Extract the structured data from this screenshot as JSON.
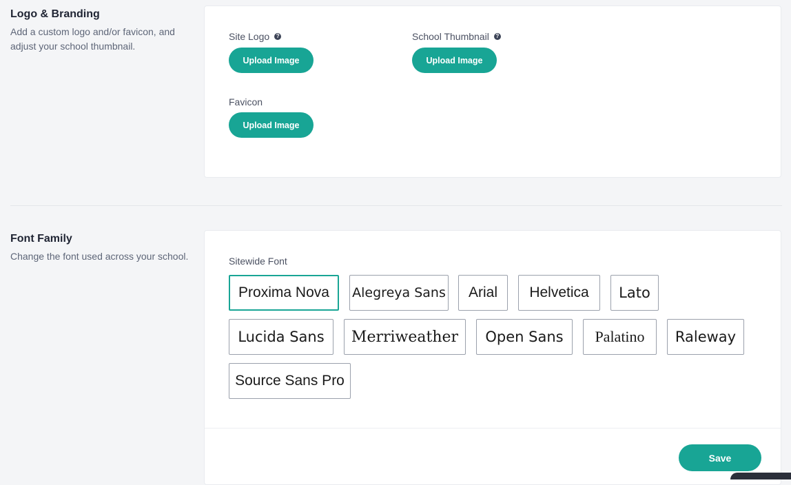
{
  "logo_branding": {
    "title": "Logo & Branding",
    "description": "Add a custom logo and/or favicon, and adjust your school thumbnail.",
    "fields": {
      "site_logo": {
        "label": "Site Logo",
        "help_icon": "question-circle-icon",
        "button": "Upload Image"
      },
      "school_thumbnail": {
        "label": "School Thumbnail",
        "help_icon": "question-circle-icon",
        "button": "Upload Image"
      },
      "favicon": {
        "label": "Favicon",
        "button": "Upload Image"
      }
    }
  },
  "font_family": {
    "title": "Font Family",
    "description": "Change the font used across your school.",
    "label": "Sitewide Font",
    "selected": "Proxima Nova",
    "options": [
      "Proxima Nova",
      "Alegreya Sans",
      "Arial",
      "Helvetica",
      "Lato",
      "Lucida Sans",
      "Merriweather",
      "Open Sans",
      "Palatino",
      "Raleway",
      "Source Sans Pro"
    ],
    "save_label": "Save"
  },
  "colors": {
    "accent": "#18a595",
    "selected_border": "#18a595",
    "option_border": "#9aa0ab",
    "background": "#f4f5f7",
    "card": "#ffffff"
  }
}
